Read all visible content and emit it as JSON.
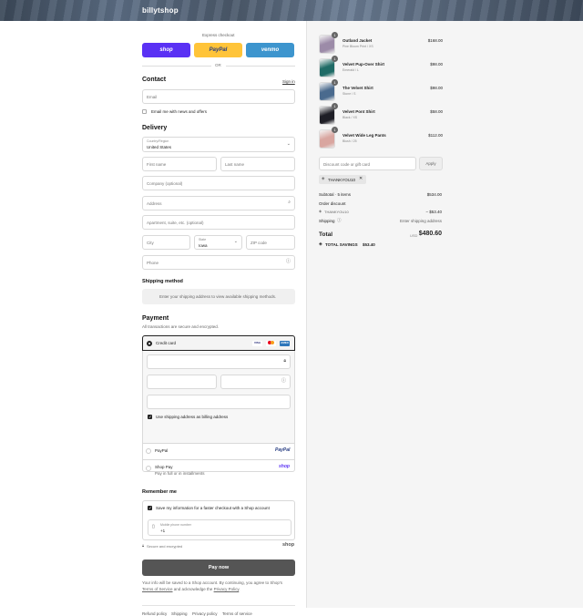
{
  "header": {
    "brand": "billytshop"
  },
  "express": {
    "title": "Express checkout",
    "shop": "shop",
    "paypal": "PayPal",
    "venmo": "venmo",
    "or": "OR"
  },
  "contact": {
    "title": "Contact",
    "sign_in": "Sign in",
    "email_ph": "Email",
    "news_label": "Email me with news and offers"
  },
  "delivery": {
    "title": "Delivery",
    "country_label": "Country/Region",
    "country_value": "United States",
    "first_name": "First name",
    "last_name": "Last name",
    "company": "Company (optional)",
    "address": "Address",
    "apartment": "Apartment, suite, etc. (optional)",
    "city": "City",
    "state_label": "State",
    "state_value": "Iowa",
    "zip": "ZIP code",
    "phone": "Phone"
  },
  "shipping_method": {
    "title": "Shipping method",
    "note": "Enter your shipping address to view available shipping methods."
  },
  "payment": {
    "title": "Payment",
    "subtitle": "All transactions are secure and encrypted.",
    "credit_card": "Credit card",
    "cards": [
      "VISA",
      "MC",
      "AMEX"
    ],
    "billing_label": "Use shipping address as billing address",
    "paypal": "PayPal",
    "paypal_logo": "PayPal",
    "shoppay": "Shop Pay",
    "shoppay_sub": "Pay in full or in installments",
    "shoppay_logo": "shop"
  },
  "remember": {
    "title": "Remember me",
    "save_label": "Save my information for a faster checkout with a Shop account",
    "mobile_label": "Mobile phone number",
    "mobile_value": "+1",
    "secure": "Secure and encrypted",
    "shop_logo": "shop"
  },
  "pay_now": "Pay now",
  "legal": {
    "line1": "Your info will be saved to a Shop account. By continuing, you agree to Shop's",
    "tos": "Terms of Service",
    "and": "and acknowledge the",
    "privacy": "Privacy Policy",
    "period": "."
  },
  "footer": {
    "refund": "Refund policy",
    "shipping": "Shipping",
    "privacy": "Privacy policy",
    "terms": "Terms of service"
  },
  "cart": {
    "items": [
      {
        "name": "Outland Jacket",
        "variant": "Pine Bloom Print / XS",
        "price": "$168.00",
        "qty": "1",
        "color": "#9c8ba8"
      },
      {
        "name": "Velvet Pup-Over Shirt",
        "variant": "Emerald / L",
        "price": "$98.00",
        "qty": "1",
        "color": "#1f6b66"
      },
      {
        "name": "The Velvet Shirt",
        "variant": "Stone / S",
        "price": "$98.00",
        "qty": "1",
        "color": "#4a6a8e"
      },
      {
        "name": "Velvet Pont Shirt",
        "variant": "Black / XS",
        "price": "$58.00",
        "qty": "1",
        "color": "#1e1e26"
      },
      {
        "name": "Velvet Wide Leg Pants",
        "variant": "Blush / 25",
        "price": "$112.00",
        "qty": "1",
        "color": "#d9a6a0"
      }
    ],
    "discount_ph": "Discount code or gift card",
    "apply": "Apply",
    "code_chip": "THANKYOU10",
    "subtotal_label": "Subtotal · 5 items",
    "subtotal_value": "$534.00",
    "order_discount": "Order discount",
    "discount_code": "THANKYOU10",
    "discount_value": "− $53.40",
    "shipping_label": "Shipping",
    "shipping_value": "Enter shipping address",
    "total_label": "Total",
    "currency": "USD",
    "total_value": "$480.60",
    "savings_label": "TOTAL SAVINGS",
    "savings_value": "$53.40"
  }
}
